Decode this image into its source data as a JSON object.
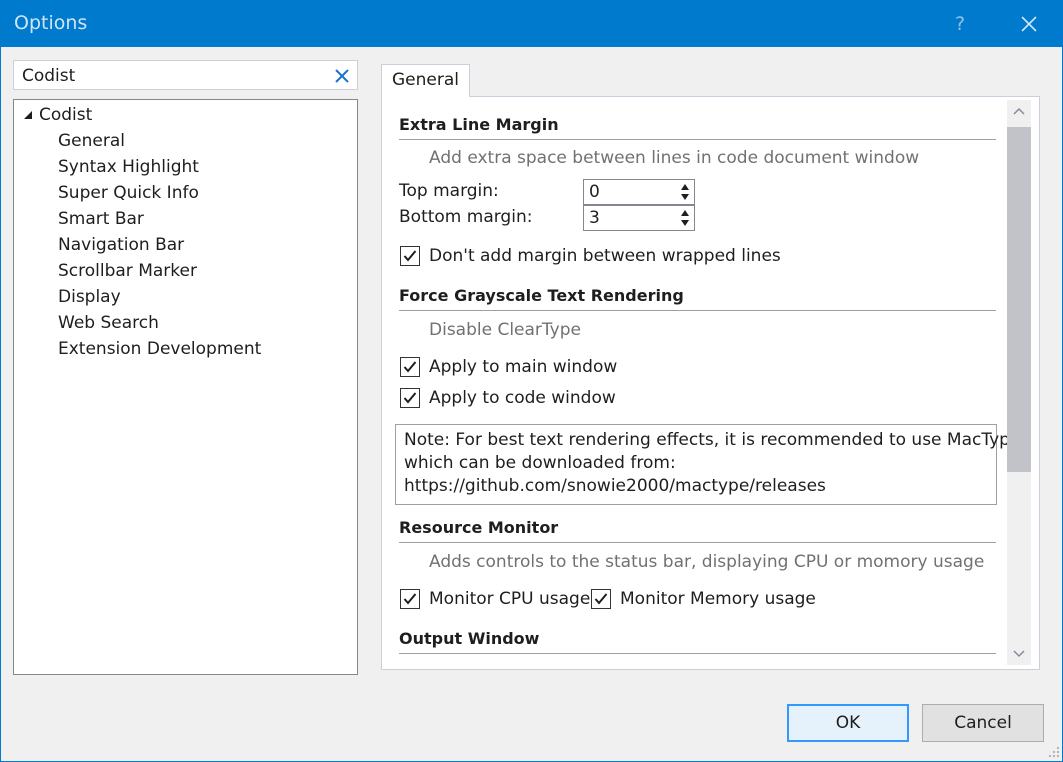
{
  "window": {
    "title": "Options",
    "help_label": "?",
    "close_icon": "close-icon"
  },
  "search": {
    "value": "Codist",
    "clear_icon": "clear-icon"
  },
  "tree": {
    "root": "Codist",
    "items": [
      "General",
      "Syntax Highlight",
      "Super Quick Info",
      "Smart Bar",
      "Navigation Bar",
      "Scrollbar Marker",
      "Display",
      "Web Search",
      "Extension Development"
    ]
  },
  "tab": {
    "label": "General"
  },
  "sections": {
    "extra_line_margin": {
      "title": "Extra Line Margin",
      "description": "Add extra space between lines in code document window",
      "top_margin_label": "Top margin:",
      "top_margin_value": "0",
      "bottom_margin_label": "Bottom margin:",
      "bottom_margin_value": "3",
      "no_wrap_margin_label": "Don't add margin between wrapped lines",
      "no_wrap_margin_checked": true
    },
    "grayscale": {
      "title": "Force Grayscale Text Rendering",
      "description": "Disable ClearType",
      "main_window_label": "Apply to main window",
      "main_window_checked": true,
      "code_window_label": "Apply to code window",
      "code_window_checked": true,
      "note_lines": [
        "Note: For best text rendering effects, it is recommended to use MacType,",
        "which can be downloaded from:",
        "https://github.com/snowie2000/mactype/releases"
      ]
    },
    "resource_monitor": {
      "title": "Resource Monitor",
      "description": "Adds controls to the status bar, displaying CPU or momory usage",
      "cpu_label": "Monitor CPU usage",
      "cpu_checked": true,
      "memory_label": "Monitor Memory usage",
      "memory_checked": true
    },
    "output_window": {
      "title": "Output Window"
    }
  },
  "buttons": {
    "ok": "OK",
    "cancel": "Cancel"
  },
  "colors": {
    "titlebar": "#007acc",
    "accent": "#3399ff"
  }
}
